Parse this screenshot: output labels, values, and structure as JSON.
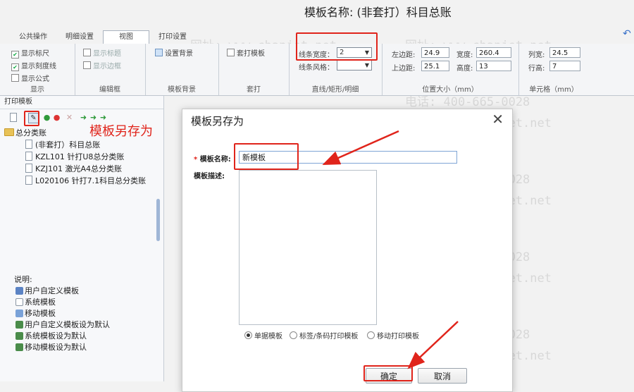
{
  "template_title": "模板名称:   (非套打）科目总账",
  "tabs": [
    "公共操作",
    "明细设置",
    "视图",
    "打印设置"
  ],
  "active_tab": "视图",
  "ribbon": {
    "display": {
      "group": "显示",
      "show_ruler": "显示标尺",
      "show_scale": "显示刻度线",
      "show_formula": "显示公式"
    },
    "edit_frame": {
      "group": "编辑框",
      "show_title": "显示标题",
      "show_border": "显示边框"
    },
    "background": {
      "group": "模板背景",
      "set_bg": "设置背景"
    },
    "overlay": {
      "group": "套打",
      "overlay_template": "套打模板"
    },
    "line": {
      "group": "直线/矩形/明细",
      "width_label": "线条宽度：",
      "width_value": "2",
      "style_label": "线条风格："
    },
    "position": {
      "group": "位置大小（mm）",
      "left_label": "左边距:",
      "left_value": "24.9",
      "top_label": "上边距:",
      "top_value": "25.1",
      "width_label": "宽度:",
      "width_value": "260.4",
      "height_label": "高度:",
      "height_value": "13"
    },
    "cell": {
      "group": "单元格（mm）",
      "col_label": "列宽:",
      "col_value": "24.5",
      "row_label": "行高:",
      "row_value": "7"
    }
  },
  "left_panel": {
    "header": "打印模板",
    "tree": {
      "root": "总分类账",
      "items": [
        "(非套打）科目总账",
        "KZL101 针打U8总分类账",
        "KZJ101 激光A4总分类账",
        "L020106 针打7.1科目总分类账"
      ]
    },
    "legend_title": "说明:",
    "legend": [
      "用户自定义模板",
      "系统模板",
      "移动模板",
      "用户自定义模板设为默认",
      "系统模板设为默认",
      "移动模板设为默认"
    ]
  },
  "annotation": "模板另存为",
  "dialog": {
    "title": "模板另存为",
    "close": "✕",
    "required_mark": "*",
    "name_label": "模板名称:",
    "name_value": "新模板",
    "desc_label": "模板描述:",
    "radios": [
      "单据模板",
      "标签/条码打印模板",
      "移动打印模板"
    ],
    "ok": "确定",
    "cancel": "取消"
  },
  "watermark": {
    "phone": "电话: 400-665-0028",
    "site": "网址: www.chanjet.net"
  },
  "colors": {
    "highlight": "#e0241b",
    "accent": "#3a72c9"
  }
}
